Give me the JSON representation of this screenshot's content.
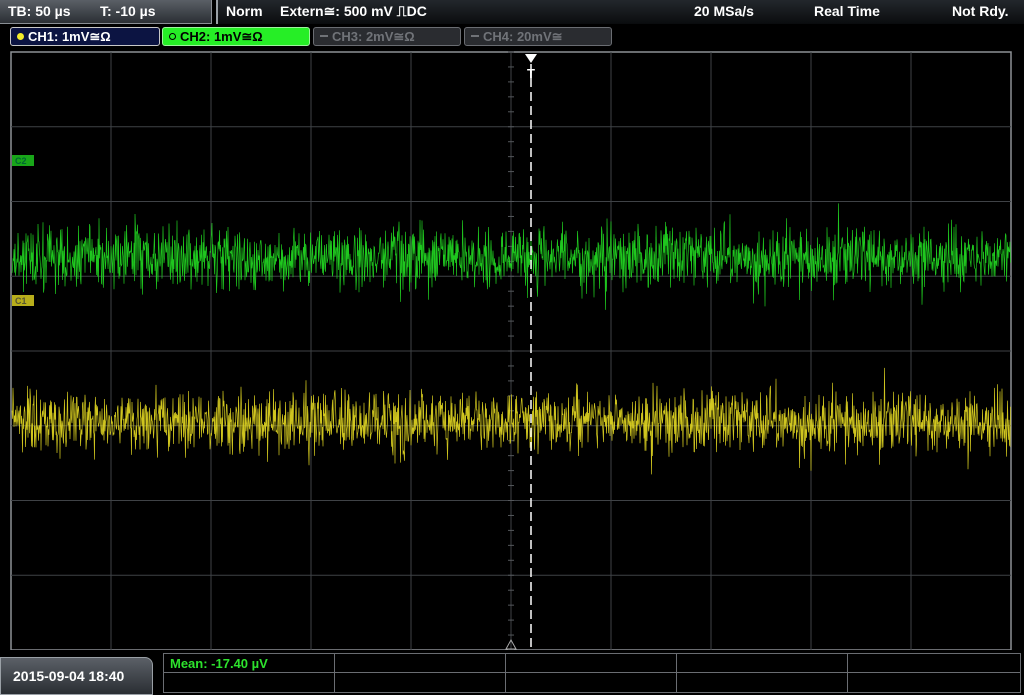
{
  "timebase": {
    "tb_label": "TB: 50 µs",
    "trigger_time_label": "T: -10 µs"
  },
  "status": {
    "mode": "Norm",
    "trigger": "Extern≅: 500 mV ⎍DC",
    "sample_rate": "20 MSa/s",
    "acq_mode": "Real Time",
    "state": "Not Rdy."
  },
  "channels": [
    {
      "label": "CH1: 1mV≅Ω",
      "active": true,
      "color": "#f4ec2a"
    },
    {
      "label": "CH2: 1mV≅Ω",
      "active": true,
      "selected": true,
      "color": "#26ee26"
    },
    {
      "label": "CH3: 2mV≅Ω",
      "active": false,
      "color": "#707378"
    },
    {
      "label": "CH4: 20mV≅",
      "active": false,
      "color": "#707378"
    }
  ],
  "trace_markers": {
    "ch2": "C2",
    "ch1": "C1",
    "trigger": "T"
  },
  "traces": {
    "ch2": {
      "color": "#22dd22",
      "level_div": 2.75
    },
    "ch1": {
      "color": "#e6da22",
      "level_div": 4.95
    }
  },
  "footer": {
    "datetime": "2015-09-04 18:40",
    "measurement": "Mean: -17.40 µV"
  }
}
